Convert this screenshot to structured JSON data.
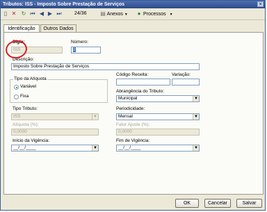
{
  "window": {
    "title": "Tributos: ISS - Imposto Sobre Prestação de Serviços",
    "close_glyph": "×"
  },
  "toolbar": {
    "icons": [
      "new-icon",
      "delete-icon",
      "refresh-icon",
      "first-record-icon",
      "previous-record-icon",
      "next-record-icon",
      "last-record-icon",
      "anexos-icon",
      "processos-icon"
    ],
    "record_position": "24/36",
    "anexos_label": "Anexos",
    "processos_label": "Processos"
  },
  "tabs": [
    {
      "label": "Identificação"
    },
    {
      "label": "Outros Dados"
    }
  ],
  "form": {
    "sigla_label": "Sigla:",
    "sigla_value": "ISS",
    "numero_label": "Número:",
    "numero_value": "2",
    "descricao_label": "Descrição:",
    "descricao_value": "Imposto Sobre Prestação de Serviços",
    "codigo_receita_label": "Código Receita:",
    "codigo_receita_value": "",
    "variacao_label": "Variação:",
    "variacao_value": "",
    "tipo_aliquota_label": "Tipo da Alíquota",
    "tipo_aliquota_options": [
      "Variável",
      "Fixa"
    ],
    "tipo_aliquota_selected": "Variável",
    "abrangencia_label": "Abrangência do Tributo:",
    "abrangencia_value": "Municipal",
    "tipo_tributo_label": "Tipo Tributo:",
    "tipo_tributo_value": "ISS",
    "periodicidade_label": "Periodicidade:",
    "periodicidade_value": "Mensal",
    "aliquota_label": "Alíquota (%):",
    "aliquota_value": "0,0000",
    "fator_ajuste_label": "Fator Ajuste (%):",
    "fator_ajuste_value": "0,0000",
    "inicio_vigencia_label": "Início da Vigência:",
    "inicio_vigencia_value": "__/__/____",
    "fim_vigencia_label": "Fim de Vigência:",
    "fim_vigencia_value": "__/__/____"
  },
  "buttons": {
    "ok": "OK",
    "cancel": "Cancelar",
    "save": "Salvar"
  },
  "colors": {
    "title_bar": "#2a4a8c",
    "annotation_circle": "#d51e1e"
  }
}
